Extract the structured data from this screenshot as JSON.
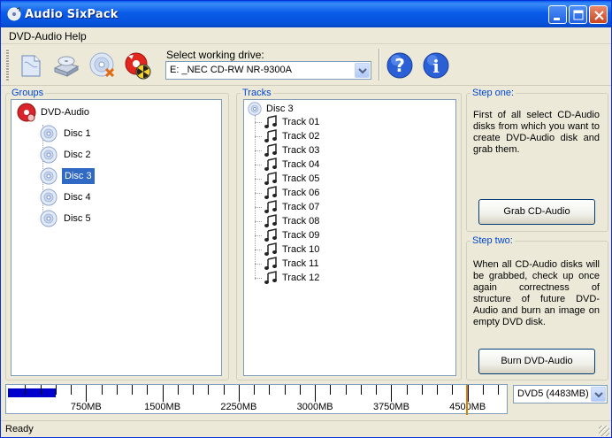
{
  "window": {
    "title": "Audio SixPack"
  },
  "menu": [
    {
      "label": "DVD-Audio"
    },
    {
      "label": "Help"
    }
  ],
  "toolbar": {
    "drive_label": "Select working drive:",
    "drive_value": "E:  _NEC CD-RW NR-9300A",
    "icons": [
      "new-project-icon",
      "hard-disk-drive-icon",
      "remove-disc-icon",
      "burn-radioactive-icon",
      "help-icon",
      "info-icon"
    ]
  },
  "groups": {
    "label": "Groups",
    "root": "DVD-Audio",
    "items": [
      "Disc 1",
      "Disc 2",
      "Disc 3",
      "Disc 4",
      "Disc 5"
    ],
    "selected": "Disc 3"
  },
  "tracks": {
    "label": "Tracks",
    "root": "Disc 3",
    "items": [
      "Track 01",
      "Track 02",
      "Track 03",
      "Track 04",
      "Track 05",
      "Track 06",
      "Track 07",
      "Track 08",
      "Track 09",
      "Track 10",
      "Track 11",
      "Track 12"
    ]
  },
  "step_one": {
    "label": "Step one:",
    "text": "First of all select CD-Audio disks from which you want to create DVD-Audio disk and grab them.",
    "button": "Grab CD-Audio"
  },
  "step_two": {
    "label": "Step two:",
    "text": "When all CD-Audio disks will be grabbed, check up once again correctness of structure of future DVD-Audio and burn an image on empty DVD disk.",
    "button": "Burn DVD-Audio"
  },
  "capacity": {
    "tick_labels": [
      "750MB",
      "1500MB",
      "2250MB",
      "3000MB",
      "3750MB",
      "4500MB"
    ],
    "used_mb": 470,
    "limit_mb": 4483,
    "scale_max_mb": 4850,
    "media_value": "DVD5 (4483MB)"
  },
  "status": {
    "text": "Ready"
  },
  "colors": {
    "accent": "#0046d5",
    "selection": "#316ac5",
    "fill": "#0000cc",
    "limit": "#e08000"
  }
}
